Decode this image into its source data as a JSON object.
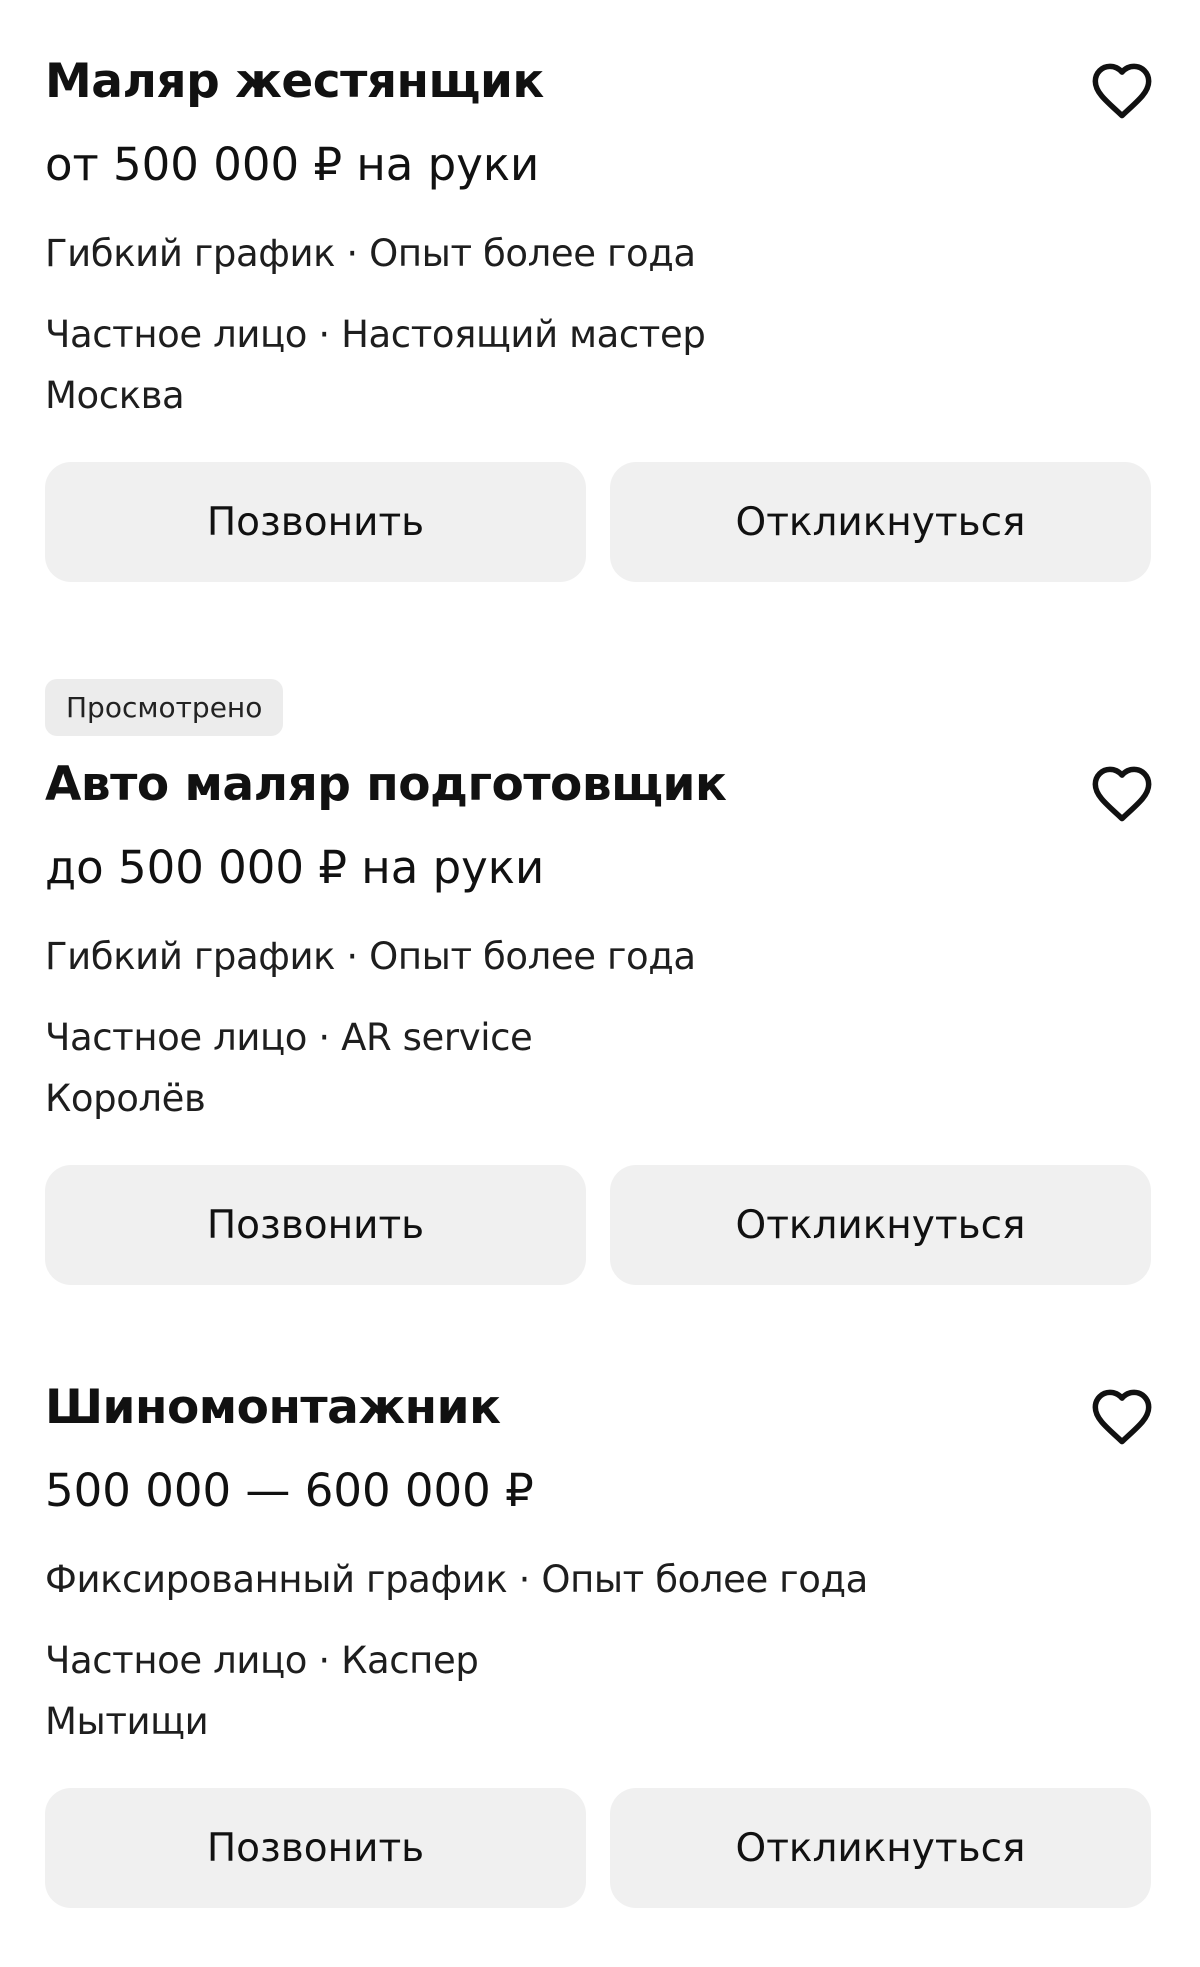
{
  "vacancies": [
    {
      "badge": "",
      "title": "Маляр жестянщик",
      "salary": "от 500 000 ₽ на руки",
      "schedule": "Гибкий график · Опыт более года",
      "employer": "Частное лицо · Настоящий мастер",
      "city": "Москва",
      "call_label": "Позвонить",
      "reply_label": "Откликнуться"
    },
    {
      "badge": "Просмотрено",
      "title": "Авто маляр подготовщик",
      "salary": "до 500 000 ₽ на руки",
      "schedule": "Гибкий график · Опыт более года",
      "employer": "Частное лицо · AR service",
      "city": "Королёв",
      "call_label": "Позвонить",
      "reply_label": "Откликнуться"
    },
    {
      "badge": "",
      "title": "Шиномонтажник",
      "salary": "500 000 — 600 000 ₽",
      "schedule": "Фиксированный график · Опыт более года",
      "employer": "Частное лицо · Каспер",
      "city": "Мытищи",
      "call_label": "Позвонить",
      "reply_label": "Откликнуться"
    }
  ],
  "icons": {
    "favorite": "heart-outline-icon"
  },
  "colors": {
    "button_bg": "#f0f0f0",
    "badge_bg": "#ececec",
    "text": "#111111"
  }
}
